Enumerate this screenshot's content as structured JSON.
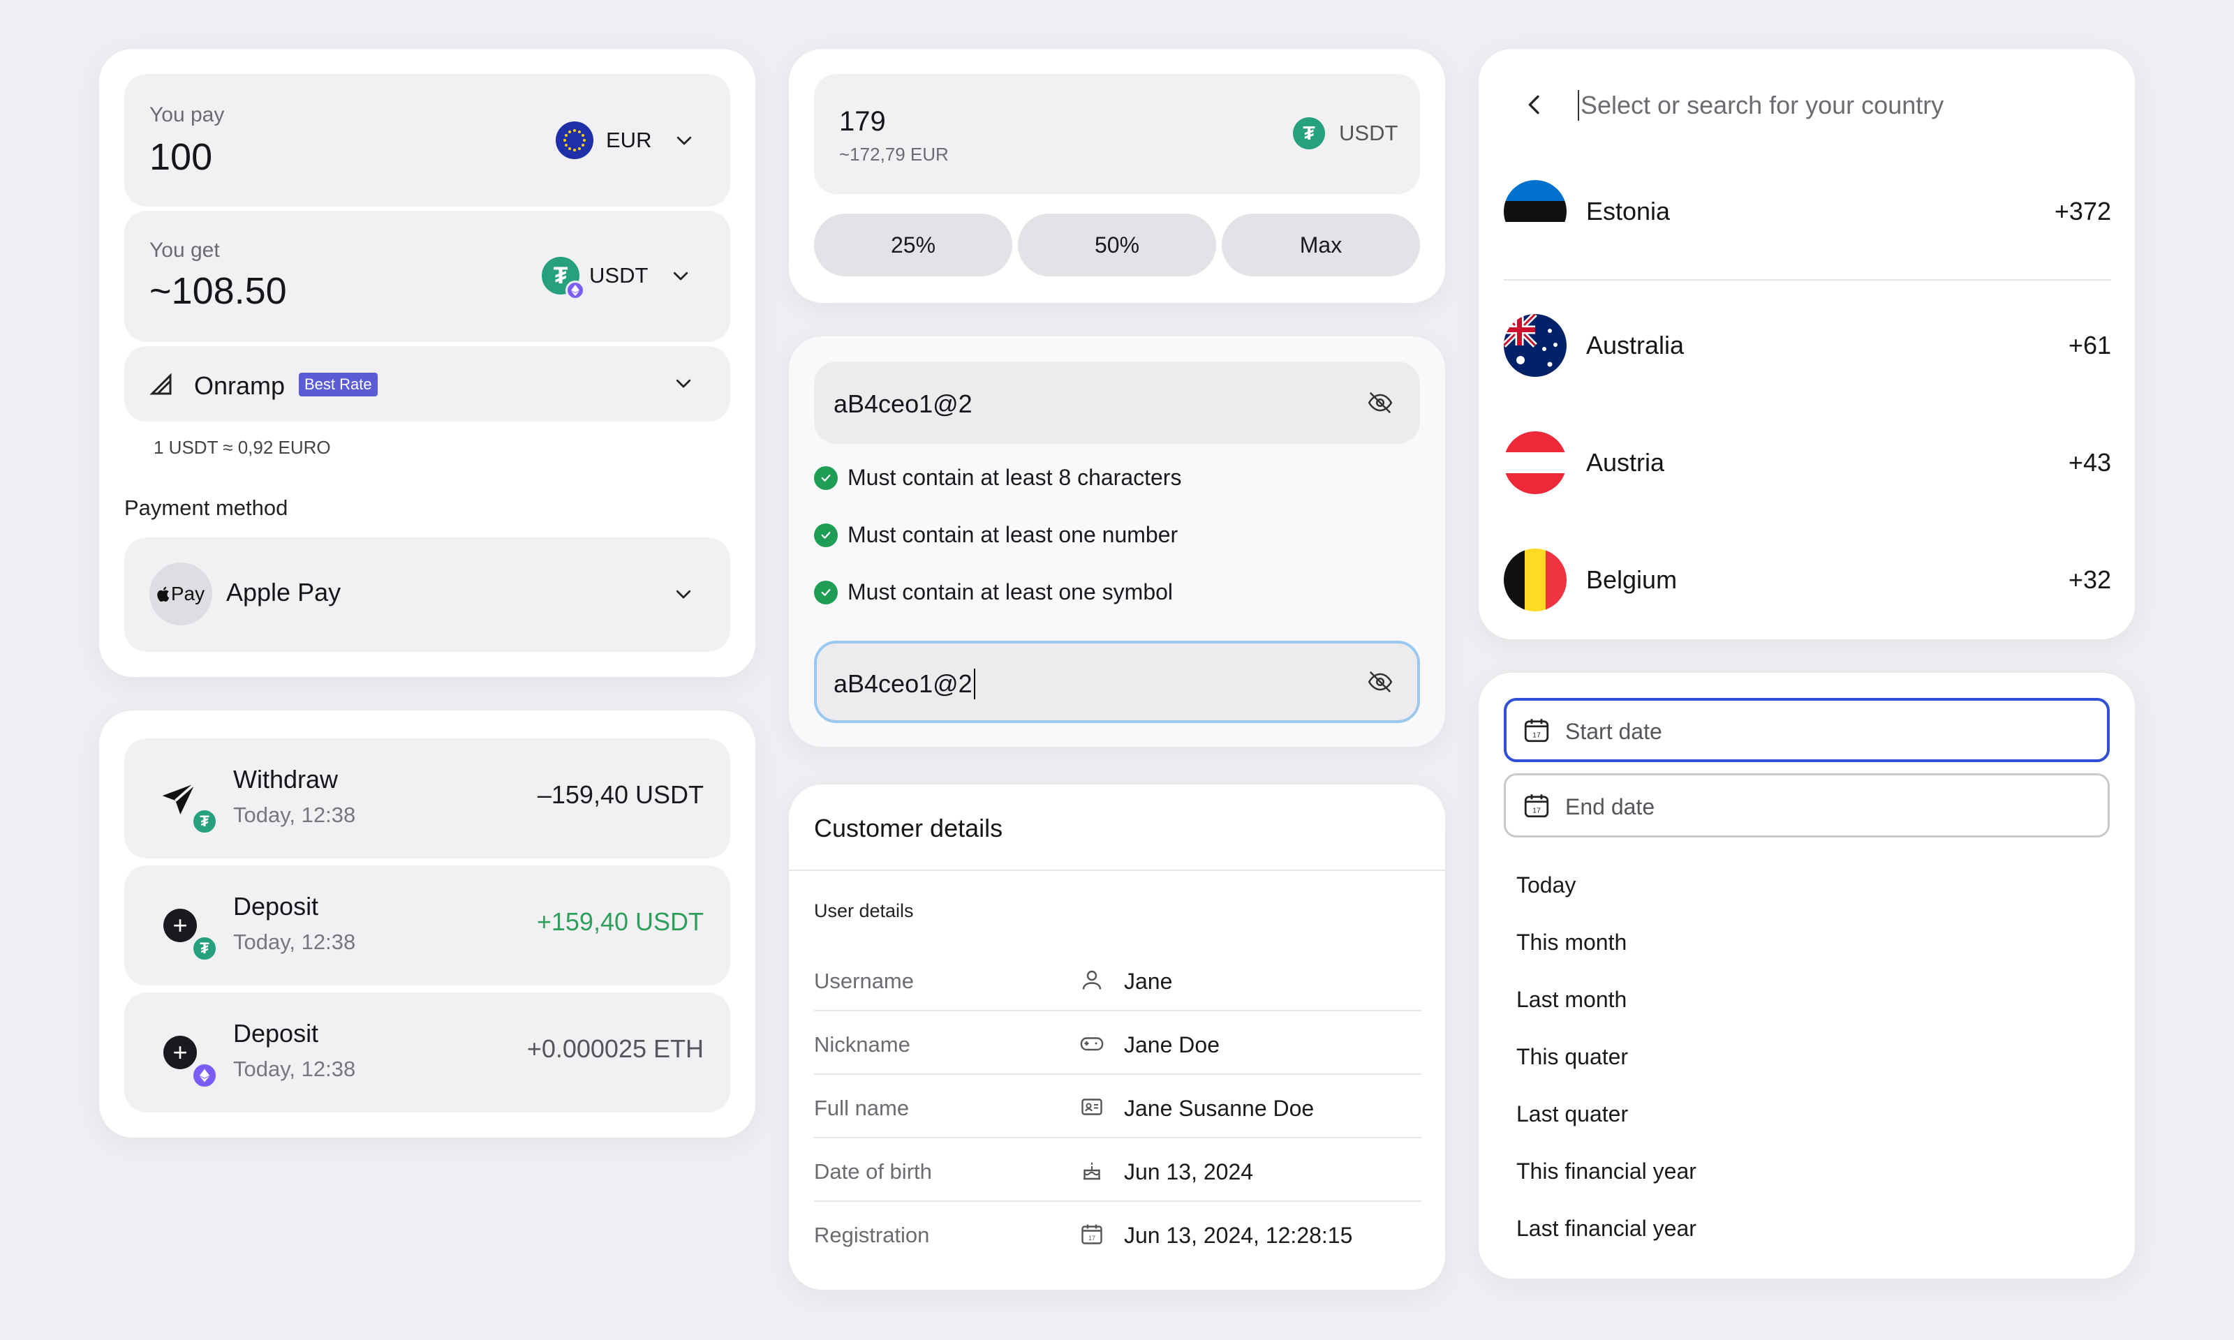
{
  "swap": {
    "pay_label": "You pay",
    "pay_amount": "100",
    "pay_currency": "EUR",
    "get_label": "You get",
    "get_amount": "~108.50",
    "get_currency": "USDT",
    "provider": "Onramp",
    "provider_badge": "Best Rate",
    "rate": "1 USDT ≈ 0,92 EURO",
    "payment_label": "Payment method",
    "payment_logo": "Pay",
    "payment_method": "Apple Pay"
  },
  "transactions": [
    {
      "title": "Withdraw",
      "time": "Today, 12:38",
      "amount": "–159,40 USDT",
      "icon": "send-icon",
      "badge": "tether-icon"
    },
    {
      "title": "Deposit",
      "time": "Today, 12:38",
      "amount": "+159,40 USDT",
      "icon": "plus-icon",
      "badge": "tether-icon"
    },
    {
      "title": "Deposit",
      "time": "Today, 12:38",
      "amount": "+0.000025 ETH",
      "icon": "plus-icon",
      "badge": "ethereum-icon"
    }
  ],
  "amount_input": {
    "value": "179",
    "converted": "~172,79 EUR",
    "currency": "USDT",
    "presets": [
      "25%",
      "50%",
      "Max"
    ]
  },
  "password": {
    "value": "aB4ceo1@2",
    "rules": [
      "Must contain at least 8 characters",
      "Must contain at least one number",
      "Must contain at least one symbol"
    ],
    "confirm_value": "aB4ceo1@2"
  },
  "customer": {
    "title": "Customer details",
    "section": "User details",
    "rows": [
      {
        "label": "Username",
        "value": "Jane",
        "icon": "user-icon"
      },
      {
        "label": "Nickname",
        "value": "Jane Doe",
        "icon": "gamepad-icon"
      },
      {
        "label": "Full name",
        "value": "Jane Susanne Doe",
        "icon": "id-card-icon"
      },
      {
        "label": "Date of birth",
        "value": "Jun 13, 2024",
        "icon": "cake-icon"
      },
      {
        "label": "Registration",
        "value": "Jun 13, 2024, 12:28:15",
        "icon": "calendar-icon"
      }
    ]
  },
  "country": {
    "placeholder": "Select or search for your country",
    "selected": {
      "name": "Estonia",
      "code": "+372"
    },
    "list": [
      {
        "name": "Australia",
        "code": "+61"
      },
      {
        "name": "Austria",
        "code": "+43"
      },
      {
        "name": "Belgium",
        "code": "+32"
      }
    ]
  },
  "dates": {
    "start_placeholder": "Start date",
    "end_placeholder": "End date",
    "calendar_day": "17",
    "options": [
      "Today",
      "This month",
      "Last month",
      "This quater",
      "Last quater",
      "This financial year",
      "Last financial year"
    ]
  },
  "colors": {
    "accent_blue": "#2f4fd6",
    "tether_green": "#26a17b",
    "positive_green": "#2e9e5b",
    "badge_purple": "#5b5bd6",
    "focus_ring": "#9cc8ee"
  }
}
